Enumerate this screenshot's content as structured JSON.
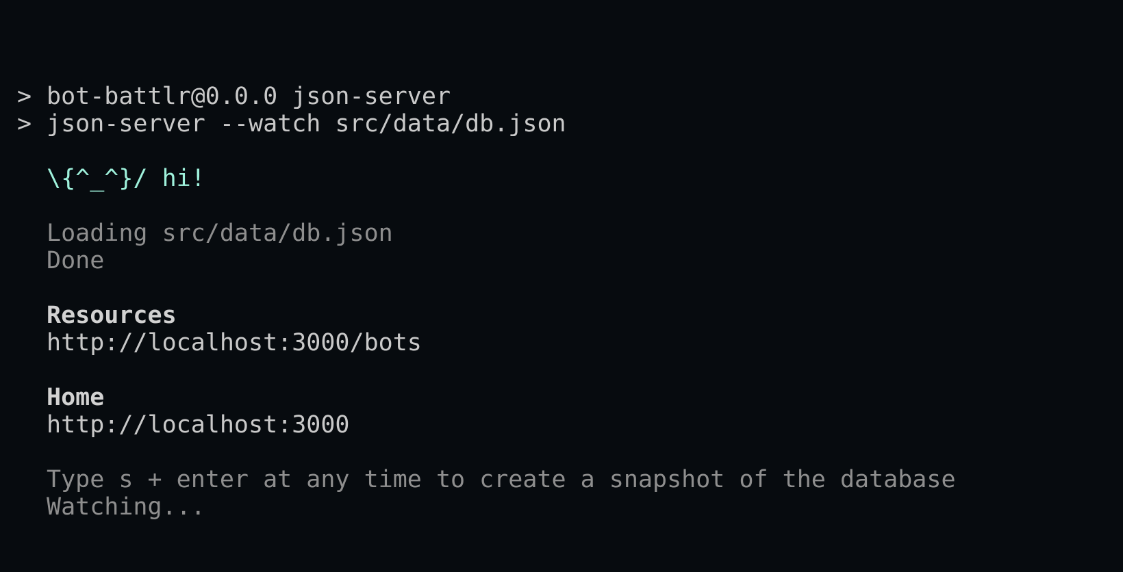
{
  "terminal": {
    "prompt_symbol": ">",
    "lines": {
      "script": "bot-battlr@0.0.0 json-server",
      "command": "json-server --watch src/data/db.json",
      "greeting": "\\{^_^}/ hi!",
      "loading": "Loading src/data/db.json",
      "done": "Done",
      "resources_heading": "Resources",
      "resources_url": "http://localhost:3000/bots",
      "home_heading": "Home",
      "home_url": "http://localhost:3000",
      "snapshot_hint": "Type s + enter at any time to create a snapshot of the database",
      "watching": "Watching..."
    }
  },
  "colors": {
    "background": "#070b0f",
    "text": "#c9c9c9",
    "dim_text": "#8e8e8e",
    "greeting": "#9ff2dc"
  }
}
